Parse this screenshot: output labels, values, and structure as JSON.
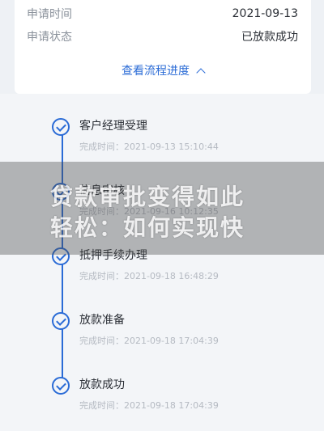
{
  "details": {
    "apply_date_label": "申请时间",
    "apply_date_value": "2021-09-13",
    "status_label": "申请状态",
    "status_value": "已放款成功",
    "progress_toggle_label": "查看流程进度"
  },
  "timeline": {
    "steps": [
      {
        "title": "客户经理受理",
        "time": "完成时间：2021-09-13 15:10:44"
      },
      {
        "title": "信息审核",
        "time": "完成时间：2021-09-16 10:12:35"
      },
      {
        "title": "抵押手续办理",
        "time": "完成时间：2021-09-18 16:48:29"
      },
      {
        "title": "放款准备",
        "time": "完成时间：2021-09-18 17:04:39"
      },
      {
        "title": "放款成功",
        "time": "完成时间：2021-09-18 17:04:39"
      }
    ]
  },
  "watermark": {
    "line1": "贷款审批变得如此",
    "line2": "轻松：如何实现快"
  },
  "colors": {
    "accent": "#2a6bd6",
    "background": "#eef1f5"
  }
}
